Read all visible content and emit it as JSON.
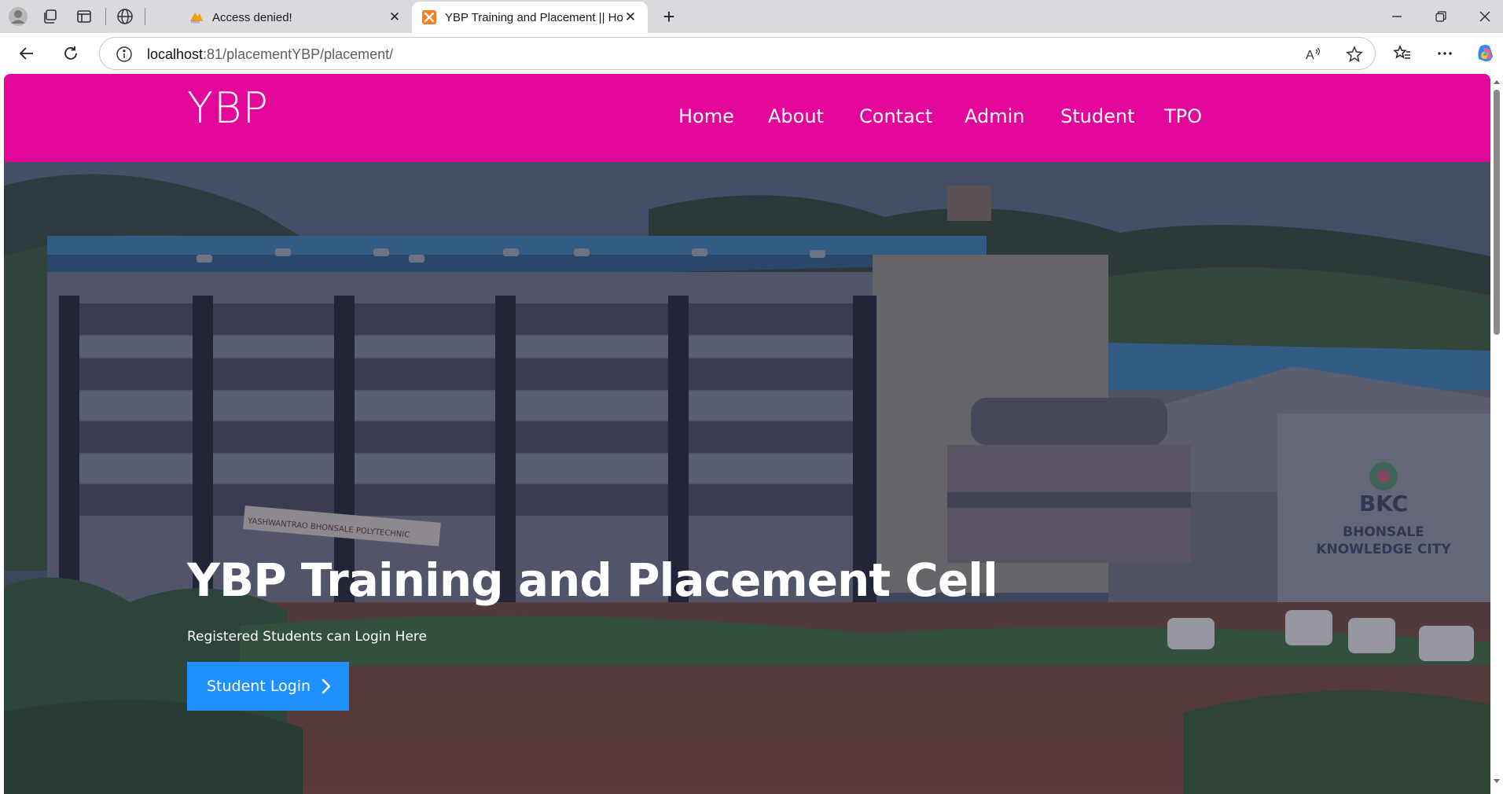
{
  "browser": {
    "tabs": [
      {
        "title": "Access denied!",
        "favicon": "phpmyadmin-icon",
        "active": false
      },
      {
        "title": "YBP Training and Placement || Hor",
        "favicon": "xampp-icon",
        "active": true
      }
    ],
    "url_host": "localhost",
    "url_rest": ":81/placementYBP/placement/"
  },
  "site": {
    "logo": "YBP",
    "nav": [
      "Home",
      "About",
      "Contact",
      "Admin",
      "Student",
      "TPO"
    ],
    "header_color": "#e4059a"
  },
  "hero": {
    "title": "YBP Training and Placement Cell",
    "subtitle": "Registered Students can Login Here",
    "button_label": "Student Login",
    "button_color": "#1e90ff",
    "building_sign": "YASHWANTRAO BHONSALE POLYTECHNIC",
    "campus_sign_1": "BKC",
    "campus_sign_2": "BHONSALE",
    "campus_sign_3": "KNOWLEDGE CITY"
  }
}
